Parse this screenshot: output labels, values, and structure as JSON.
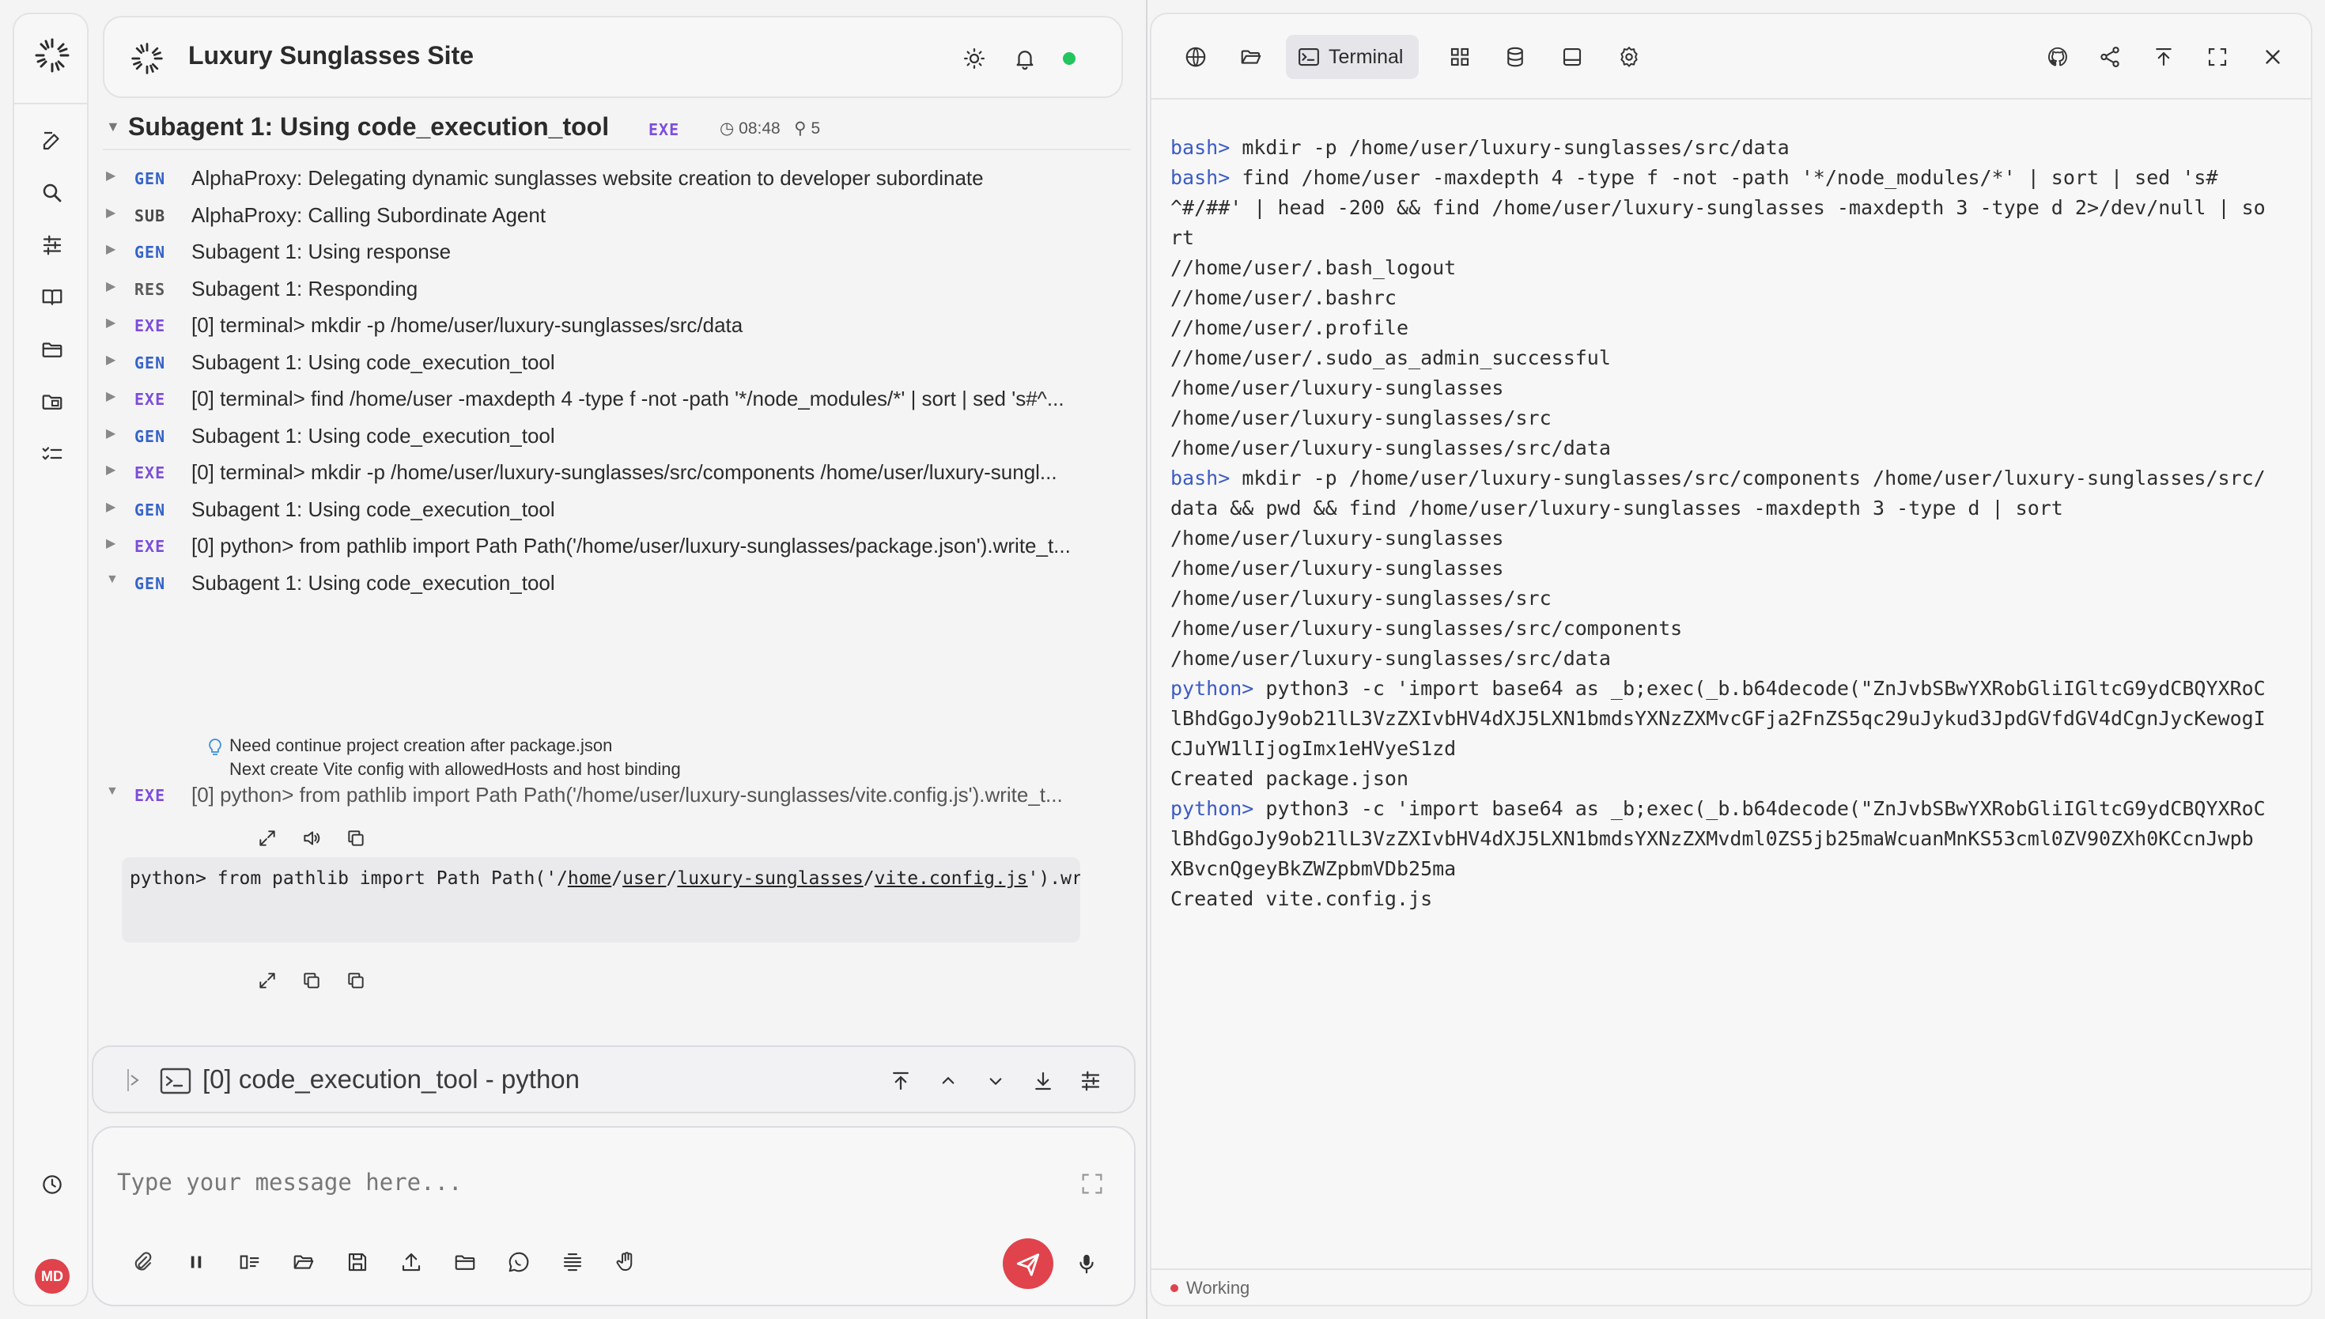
{
  "app": {
    "title": "Luxury Sunglasses Site",
    "accent": "#e0434b",
    "status_color": "#22c55e"
  },
  "rail": {
    "items": [
      {
        "icon": "edit-icon",
        "label": "new-chat"
      },
      {
        "icon": "search-icon",
        "label": "search"
      },
      {
        "icon": "sliders-icon",
        "label": "settings"
      },
      {
        "icon": "book-icon",
        "label": "library"
      },
      {
        "icon": "folder-icon",
        "label": "files"
      },
      {
        "icon": "folder-chart-icon",
        "label": "projects"
      },
      {
        "icon": "checklist-icon",
        "label": "tasks"
      },
      {
        "icon": "clock-icon",
        "label": "history"
      }
    ],
    "avatar_initials": "MD"
  },
  "group": {
    "title": "Subagent 1: Using code_execution_tool",
    "tag": "EXE",
    "time": "08:48",
    "token_count": "5"
  },
  "log": [
    {
      "tag": "GEN",
      "text": "AlphaProxy: Delegating dynamic sunglasses website creation to developer subordinate"
    },
    {
      "tag": "SUB",
      "text": "AlphaProxy: Calling Subordinate Agent"
    },
    {
      "tag": "GEN",
      "text": "Subagent 1: Using response"
    },
    {
      "tag": "RES",
      "text": "Subagent 1: Responding"
    },
    {
      "tag": "EXE",
      "text": "[0] terminal> mkdir -p /home/user/luxury-sunglasses/src/data"
    },
    {
      "tag": "GEN",
      "text": "Subagent 1: Using code_execution_tool"
    },
    {
      "tag": "EXE",
      "text": "[0] terminal> find /home/user -maxdepth 4 -type f -not -path '*/node_modules/*' | sort | sed 's#^..."
    },
    {
      "tag": "GEN",
      "text": "Subagent 1: Using code_execution_tool"
    },
    {
      "tag": "EXE",
      "text": "[0] terminal> mkdir -p /home/user/luxury-sunglasses/src/components /home/user/luxury-sungl..."
    },
    {
      "tag": "GEN",
      "text": "Subagent 1: Using code_execution_tool"
    },
    {
      "tag": "EXE",
      "text": "[0] python> from pathlib import Path Path('/home/user/luxury-sunglasses/package.json').write_t..."
    },
    {
      "tag": "GEN",
      "text": "Subagent 1: Using code_execution_tool"
    }
  ],
  "thought": {
    "line1": "Need continue project creation after package.json",
    "line2": "Next create Vite config with allowedHosts and host binding"
  },
  "exe_expanded": {
    "tag": "EXE",
    "text": "[0] python> from pathlib import Path Path('/home/user/luxury-sunglasses/vite.config.js').write_t...",
    "code_prefix": "python> from pathlib import Path Path('/",
    "code_home": "home",
    "code_user": "user",
    "code_dir": "luxury-sunglasses",
    "code_file": "vite.config.js",
    "code_suffix": "').wri"
  },
  "process_bar": {
    "title": "[0] code_execution_tool - python"
  },
  "composer": {
    "placeholder": "Type your message here..."
  },
  "right_panel": {
    "active_tab": "Terminal",
    "status": "Working"
  },
  "terminal": {
    "lines": [
      {
        "prompt": "bash>",
        "text": " mkdir -p /home/user/luxury-sunglasses/src/data"
      },
      {
        "prompt": "bash>",
        "text": " find /home/user -maxdepth 4 -type f -not -path '*/node_modules/*' | sort | sed 's#"
      },
      {
        "prompt": "",
        "text": "^#/##' | head -200 && find /home/user/luxury-sunglasses -maxdepth 3 -type d 2>/dev/null | so"
      },
      {
        "prompt": "",
        "text": "rt"
      },
      {
        "prompt": "",
        "text": "//home/user/.bash_logout"
      },
      {
        "prompt": "",
        "text": "//home/user/.bashrc"
      },
      {
        "prompt": "",
        "text": "//home/user/.profile"
      },
      {
        "prompt": "",
        "text": "//home/user/.sudo_as_admin_successful"
      },
      {
        "prompt": "",
        "text": "/home/user/luxury-sunglasses"
      },
      {
        "prompt": "",
        "text": "/home/user/luxury-sunglasses/src"
      },
      {
        "prompt": "",
        "text": "/home/user/luxury-sunglasses/src/data"
      },
      {
        "prompt": "bash>",
        "text": " mkdir -p /home/user/luxury-sunglasses/src/components /home/user/luxury-sunglasses/src/"
      },
      {
        "prompt": "",
        "text": "data && pwd && find /home/user/luxury-sunglasses -maxdepth 3 -type d | sort"
      },
      {
        "prompt": "",
        "text": "/home/user/luxury-sunglasses"
      },
      {
        "prompt": "",
        "text": "/home/user/luxury-sunglasses"
      },
      {
        "prompt": "",
        "text": "/home/user/luxury-sunglasses/src"
      },
      {
        "prompt": "",
        "text": "/home/user/luxury-sunglasses/src/components"
      },
      {
        "prompt": "",
        "text": "/home/user/luxury-sunglasses/src/data"
      },
      {
        "prompt": "python>",
        "text": " python3 -c 'import base64 as _b;exec(_b.b64decode(\"ZnJvbSBwYXRobGliIGltcG9ydCBQYXRoC"
      },
      {
        "prompt": "",
        "text": "lBhdGgoJy9ob21lL3VzZXIvbHV4dXJ5LXN1bmdsYXNzZXMvcGFja2FnZS5qc29uJykud3JpdGVfdGV4dCgnJycKewogI"
      },
      {
        "prompt": "",
        "text": "CJuYW1lIjogImx1eHVyeS1zd"
      },
      {
        "prompt": "",
        "text": "Created package.json"
      },
      {
        "prompt": "python>",
        "text": " python3 -c 'import base64 as _b;exec(_b.b64decode(\"ZnJvbSBwYXRobGliIGltcG9ydCBQYXRoC"
      },
      {
        "prompt": "",
        "text": "lBhdGgoJy9ob21lL3VzZXIvbHV4dXJ5LXN1bmdsYXNzZXMvdml0ZS5jb25maWcuanMnKS53cml0ZV90ZXh0KCcnJwpb"
      },
      {
        "prompt": "",
        "text": "XBvcnQgeyBkZWZpbmVDb25ma"
      },
      {
        "prompt": "",
        "text": "Created vite.config.js"
      }
    ]
  }
}
